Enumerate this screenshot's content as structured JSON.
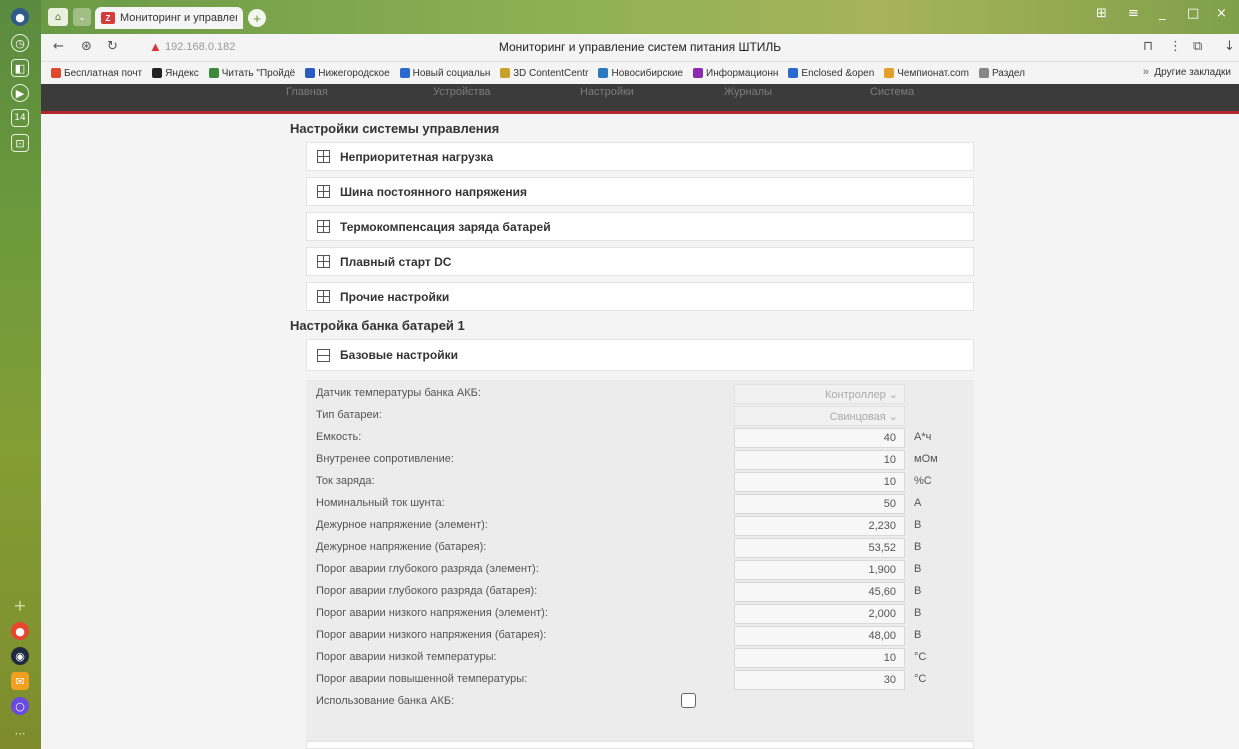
{
  "browser": {
    "tab_title": "Мониторинг и управлен ×",
    "url": "192.168.0.182",
    "page_title": "Мониторинг и управление систем питания ШТИЛЬ",
    "bookmarks": [
      {
        "label": "Бесплатная почт",
        "color": "#e04a2a"
      },
      {
        "label": "Яндекс",
        "color": "#222222"
      },
      {
        "label": "Читать \"Пройдё",
        "color": "#3a8a3a"
      },
      {
        "label": "Нижегородское",
        "color": "#2a5ac0"
      },
      {
        "label": "Новый социальн",
        "color": "#2a6ad0"
      },
      {
        "label": "3D ContentCentr",
        "color": "#c9a02a"
      },
      {
        "label": "Новосибирские",
        "color": "#2a7ac0"
      },
      {
        "label": "Информационн",
        "color": "#8a2ab0"
      },
      {
        "label": "Enclosed &open",
        "color": "#2a6ad0"
      },
      {
        "label": "Чемпионат.com",
        "color": "#e0a02a"
      },
      {
        "label": "Раздел",
        "color": "#888888"
      }
    ],
    "other_bookmarks": "Другие закладки"
  },
  "app_nav": [
    "Главная",
    "Устройства",
    "Настройки",
    "Журналы",
    "Система"
  ],
  "section1": {
    "title": "Настройки системы управления",
    "panels": [
      "Неприоритетная нагрузка",
      "Шина постоянного напряжения",
      "Термокомпенсация заряда батарей",
      "Плавный старт DC",
      "Прочие настройки"
    ]
  },
  "section2": {
    "title": "Настройка банка батарей 1",
    "panel": "Базовые настройки",
    "fields": [
      {
        "label": "Датчик температуры банка АКБ:",
        "value": "Контроллер ⌄",
        "unit": "",
        "kind": "select"
      },
      {
        "label": "Тип батареи:",
        "value": "Свинцовая ⌄",
        "unit": "",
        "kind": "select"
      },
      {
        "label": "Емкость:",
        "value": "40",
        "unit": "А*ч",
        "kind": "input"
      },
      {
        "label": "Внутренее сопротивление:",
        "value": "10",
        "unit": "мОм",
        "kind": "input"
      },
      {
        "label": "Ток заряда:",
        "value": "10",
        "unit": "%С",
        "kind": "input"
      },
      {
        "label": "Номинальный ток шунта:",
        "value": "50",
        "unit": "А",
        "kind": "input"
      },
      {
        "label": "Дежурное напряжение (элемент):",
        "value": "2,230",
        "unit": "В",
        "kind": "input"
      },
      {
        "label": "Дежурное напряжение (батарея):",
        "value": "53,52",
        "unit": "В",
        "kind": "input"
      },
      {
        "label": "Порог аварии глубокого разряда (элемент):",
        "value": "1,900",
        "unit": "В",
        "kind": "input"
      },
      {
        "label": "Порог аварии глубокого разряда (батарея):",
        "value": "45,60",
        "unit": "В",
        "kind": "input"
      },
      {
        "label": "Порог аварии низкого напряжения (элемент):",
        "value": "2,000",
        "unit": "В",
        "kind": "input"
      },
      {
        "label": "Порог аварии низкого напряжения (батарея):",
        "value": "48,00",
        "unit": "В",
        "kind": "input"
      },
      {
        "label": "Порог аварии низкой температуры:",
        "value": "10",
        "unit": "°С",
        "kind": "input"
      },
      {
        "label": "Порог аварии повышенной температуры:",
        "value": "30",
        "unit": "°С",
        "kind": "input"
      }
    ],
    "checkbox_label": "Использование банка АКБ:"
  }
}
